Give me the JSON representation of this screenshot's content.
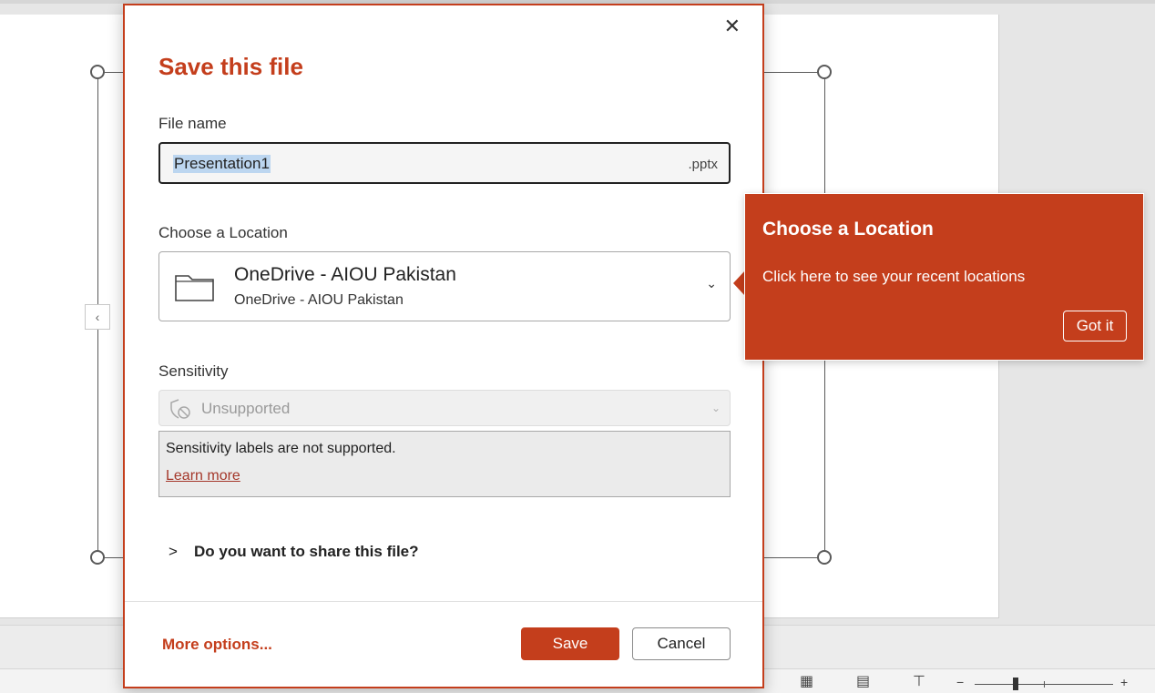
{
  "dialog": {
    "title": "Save this file",
    "close_glyph": "✕",
    "file_name_label": "File name",
    "file_name_value": "Presentation1",
    "file_extension": ".pptx",
    "location_label": "Choose a Location",
    "location_primary": "OneDrive - AIOU Pakistan",
    "location_secondary": "OneDrive - AIOU Pakistan",
    "sensitivity_label": "Sensitivity",
    "sensitivity_value": "Unsupported",
    "sensitivity_notice": "Sensitivity labels are not supported.",
    "learn_more": "Learn more",
    "share_prompt": "Do you want to share this file?",
    "more_options": "More options...",
    "save_label": "Save",
    "cancel_label": "Cancel"
  },
  "callout": {
    "title": "Choose a Location",
    "body": "Click here to see your recent locations",
    "button": "Got it"
  },
  "icons": {
    "folder": "folder-icon",
    "sensitivity": "shield-slash-icon",
    "chevron_down": "chevron-down-icon",
    "chevron_right": "chevron-right-icon",
    "close": "close-icon"
  },
  "colors": {
    "accent": "#c43e1c",
    "link": "#a4372a",
    "selection": "#bcd6f0"
  }
}
